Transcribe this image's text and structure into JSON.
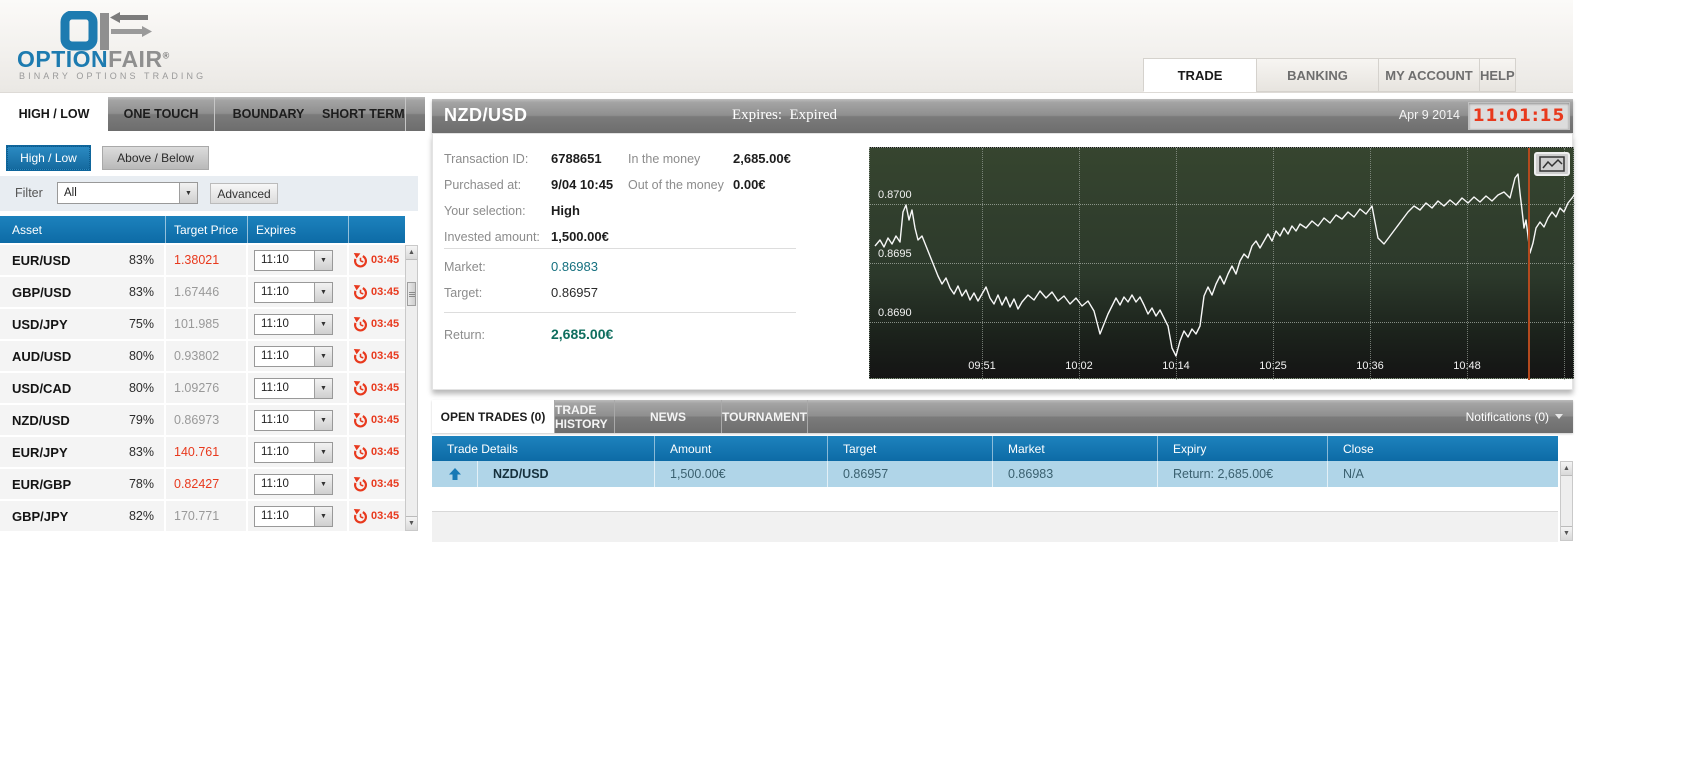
{
  "colors": {
    "accent_blue": "#1073ae",
    "alert_red": "#e8391d",
    "teal_value": "#15707f",
    "return_teal": "#0e6e5e",
    "row_blue": "#b0d5e8",
    "chart_green": "#2c392b",
    "expiry_orange": "#b44a1e"
  },
  "brand": {
    "word_primary": "OPTION",
    "word_secondary": "FAIR",
    "registered": "®",
    "tagline": "BINARY OPTIONS TRADING"
  },
  "top_nav": {
    "tabs": [
      {
        "label": "TRADE",
        "active": true
      },
      {
        "label": "BANKING",
        "active": false
      },
      {
        "label": "MY ACCOUNT",
        "active": false
      },
      {
        "label": "HELP",
        "active": false
      }
    ]
  },
  "left_panel": {
    "tabs": [
      {
        "label": "HIGH / LOW",
        "active": true
      },
      {
        "label": "ONE TOUCH",
        "active": false
      },
      {
        "label": "BOUNDARY",
        "active": false
      },
      {
        "label": "SHORT TERM",
        "active": false
      }
    ],
    "mode_buttons": [
      {
        "label": "High / Low",
        "active": true
      },
      {
        "label": "Above / Below",
        "active": false
      }
    ],
    "filter": {
      "label": "Filter",
      "value": "All",
      "advanced_label": "Advanced"
    },
    "table": {
      "headers": [
        "Asset",
        "Target Price",
        "Expires"
      ],
      "rows": [
        {
          "asset": "EUR/USD",
          "payout": "83%",
          "target_price": "1.38021",
          "highlight": true,
          "expiry": "11:10",
          "countdown": "03:45"
        },
        {
          "asset": "GBP/USD",
          "payout": "83%",
          "target_price": "1.67446",
          "highlight": false,
          "expiry": "11:10",
          "countdown": "03:45"
        },
        {
          "asset": "USD/JPY",
          "payout": "75%",
          "target_price": "101.985",
          "highlight": false,
          "expiry": "11:10",
          "countdown": "03:45"
        },
        {
          "asset": "AUD/USD",
          "payout": "80%",
          "target_price": "0.93802",
          "highlight": false,
          "expiry": "11:10",
          "countdown": "03:45"
        },
        {
          "asset": "USD/CAD",
          "payout": "80%",
          "target_price": "1.09276",
          "highlight": false,
          "expiry": "11:10",
          "countdown": "03:45"
        },
        {
          "asset": "NZD/USD",
          "payout": "79%",
          "target_price": "0.86973",
          "highlight": false,
          "expiry": "11:10",
          "countdown": "03:45"
        },
        {
          "asset": "EUR/JPY",
          "payout": "83%",
          "target_price": "140.761",
          "highlight": true,
          "expiry": "11:10",
          "countdown": "03:45"
        },
        {
          "asset": "EUR/GBP",
          "payout": "78%",
          "target_price": "0.82427",
          "highlight": true,
          "expiry": "11:10",
          "countdown": "03:45"
        },
        {
          "asset": "GBP/JPY",
          "payout": "82%",
          "target_price": "170.771",
          "highlight": false,
          "expiry": "11:10",
          "countdown": "03:45"
        }
      ]
    }
  },
  "trade_panel": {
    "symbol": "NZD/USD",
    "expires_label": "Expires:",
    "expires_value": "Expired",
    "date": "Apr 9 2014",
    "clock": "11:01:15",
    "details": {
      "transaction_label": "Transaction ID:",
      "transaction_value": "6788651",
      "purchased_label": "Purchased at:",
      "purchased_value": "9/04 10:45",
      "selection_label": "Your selection:",
      "selection_value": "High",
      "invested_label": "Invested amount:",
      "invested_value": "1,500.00€",
      "inmoney_label": "In the money",
      "inmoney_value": "2,685.00€",
      "outmoney_label": "Out of the money",
      "outmoney_value": "0.00€",
      "market_label": "Market:",
      "market_value": "0.86983",
      "target_label": "Target:",
      "target_value": "0.86957",
      "return_label": "Return:",
      "return_value": "2,685.00€"
    },
    "chart": {
      "y_labels": [
        {
          "text": "0.8700",
          "y": 41
        },
        {
          "text": "0.8695",
          "y": 100
        },
        {
          "text": "0.8690",
          "y": 159
        }
      ],
      "x_labels": [
        {
          "text": "09:51",
          "x": 112
        },
        {
          "text": "10:02",
          "x": 209
        },
        {
          "text": "10:14",
          "x": 306
        },
        {
          "text": "10:25",
          "x": 403
        },
        {
          "text": "10:36",
          "x": 500
        },
        {
          "text": "10:48",
          "x": 597
        }
      ],
      "expiry_x": 658,
      "line_points": "5,98 10,92 14,99 18,90 22,96 26,88 30,94 33,64 36,57 39,72 42,62 45,80 48,92 52,88 56,98 60,108 64,118 68,128 72,136 76,130 80,140 84,146 88,138 92,148 96,142 100,152 104,145 108,153 112,146 116,139 120,150 124,156 128,147 132,157 136,149 140,159 144,151 148,161 152,154 158,147 164,152 170,143 176,150 182,144 188,153 194,148 200,156 206,150 212,158 218,153 224,163 230,186 234,176 238,166 242,158 246,150 250,157 254,149 258,154 262,147 266,154 270,149 274,157 278,166 282,160 286,168 290,162 294,170 298,178 302,200 306,208 310,193 314,183 318,189 322,181 326,186 330,178 334,148 338,139 342,147 346,136 350,128 354,136 358,126 362,118 366,126 370,113 374,106 378,110 382,98 386,93 390,100 394,93 398,86 402,93 406,83 410,88 414,80 418,86 422,78 426,83 430,76 436,80 442,73 448,78 454,70 460,75 466,67 472,71 478,64 484,69 490,61 496,66 502,58 508,90 514,96 520,88 526,80 532,72 538,64 544,58 550,62 556,55 562,60 568,53 574,58 580,52 586,57 592,50 598,55 604,49 610,54 616,48 622,53 628,47 634,44 640,50 645,30 648,26 650,45 652,62 654,80 656,72 658,88 660,105 663,95 666,80 670,74 674,79 678,70 682,64 686,69 690,60 694,64 698,55 702,50 705,46"
    }
  },
  "chart_data": {
    "type": "line",
    "title": "NZD/USD intraday price",
    "x_ticks": [
      "09:51",
      "10:02",
      "10:14",
      "10:25",
      "10:36",
      "10:48"
    ],
    "y_ticks": [
      "0.8700",
      "0.8695",
      "0.8690"
    ],
    "ylim": [
      0.8686,
      0.8703
    ],
    "series": [
      {
        "name": "NZD/USD",
        "approx_values_at_ticks": [
          0.86955,
          0.86875,
          0.8688,
          0.869,
          0.86965,
          0.86975
        ]
      }
    ],
    "annotations": {
      "expiry_marker_time": "~10:55",
      "market_at_expiry": 0.86983
    }
  },
  "bottom_panel": {
    "tabs": [
      {
        "label": "OPEN TRADES (0)",
        "active": true
      },
      {
        "label": "TRADE HISTORY",
        "active": false
      },
      {
        "label": "NEWS",
        "active": false
      },
      {
        "label": "TOURNAMENT",
        "active": false
      }
    ],
    "notifications": "Notifications (0)",
    "table": {
      "headers": [
        "Trade Details",
        "Amount",
        "Target",
        "Market",
        "Expiry",
        "Close"
      ],
      "rows": [
        {
          "asset": "NZD/USD",
          "amount": "1,500.00€",
          "target": "0.86957",
          "market": "0.86983",
          "expiry": "Return: 2,685.00€",
          "close": "N/A"
        }
      ]
    }
  }
}
